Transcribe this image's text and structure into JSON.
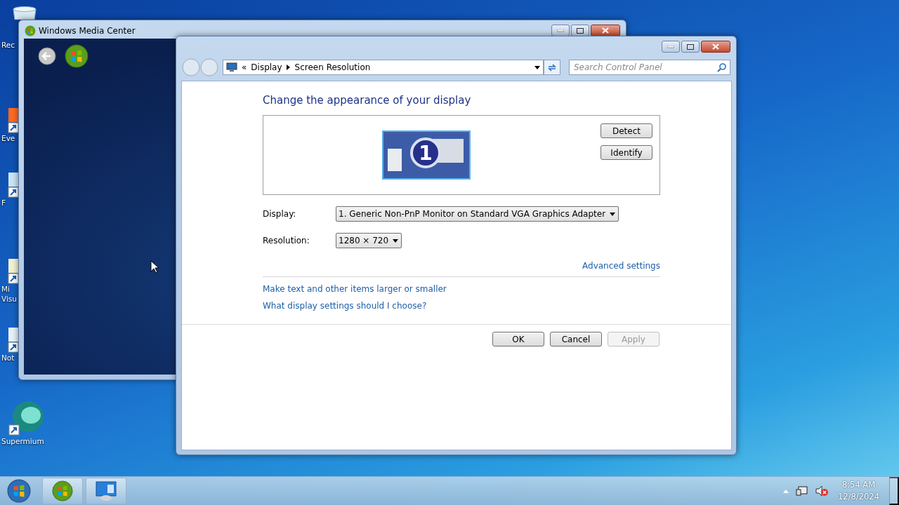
{
  "desktop_icons": [
    {
      "lines": [
        "Rec"
      ],
      "kind": "bin"
    },
    {
      "lines": [
        "Eve"
      ],
      "kind": "shortcut"
    },
    {
      "lines": [
        "F"
      ],
      "kind": "shortcut"
    },
    {
      "lines": [
        "Mi",
        "Visu"
      ],
      "kind": "shortcut"
    },
    {
      "lines": [
        "Not"
      ],
      "kind": "shortcut"
    },
    {
      "lines": [
        "Supermium"
      ],
      "kind": "browser"
    }
  ],
  "media_center": {
    "title": "Windows Media Center"
  },
  "control_panel": {
    "overflow": "«",
    "breadcrumb": [
      "Display",
      "Screen Resolution"
    ],
    "search": {
      "placeholder": "Search Control Panel"
    },
    "heading": "Change the appearance of your display",
    "monitor_number": "1",
    "side_buttons": [
      {
        "label": "Detect",
        "disabled": false
      },
      {
        "label": "Identify",
        "disabled": false
      }
    ],
    "fields": [
      {
        "label": "Display:",
        "value": "1. Generic Non-PnP Monitor on Standard VGA Graphics Adapter"
      },
      {
        "label": "Resolution:",
        "value": "1280 × 720"
      }
    ],
    "advanced_link": "Advanced settings",
    "links": [
      "Make text and other items larger or smaller",
      "What display settings should I choose?"
    ],
    "dialog_buttons": [
      {
        "label": "OK",
        "disabled": false
      },
      {
        "label": "Cancel",
        "disabled": false
      },
      {
        "label": "Apply",
        "disabled": true
      }
    ]
  },
  "taskbar": {
    "clock": {
      "time": "8:54 AM",
      "date": "12/8/2024"
    }
  }
}
